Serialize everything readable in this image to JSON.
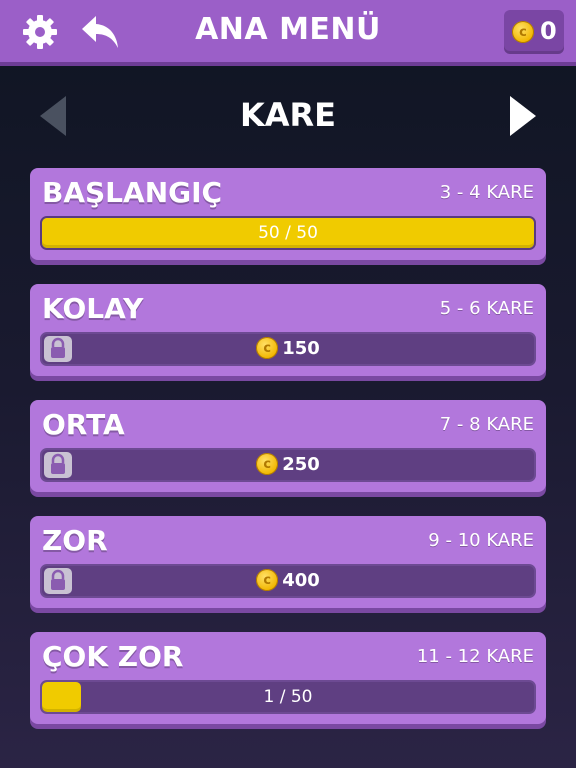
{
  "header": {
    "title": "ANA MENÜ",
    "coins": "0"
  },
  "selector": {
    "label": "KARE"
  },
  "levels": [
    {
      "name": "BAŞLANGIÇ",
      "range": "3 - 4 KARE",
      "locked": false,
      "progress_text": "50 / 50",
      "progress": 1.0
    },
    {
      "name": "KOLAY",
      "range": "5 - 6 KARE",
      "locked": true,
      "price": "150"
    },
    {
      "name": "ORTA",
      "range": "7 - 8 KARE",
      "locked": true,
      "price": "250"
    },
    {
      "name": "ZOR",
      "range": "9 - 10 KARE",
      "locked": true,
      "price": "400"
    },
    {
      "name": "ÇOK ZOR",
      "range": "11 - 12 KARE",
      "locked": false,
      "progress_text": "1 / 50",
      "progress": 0.02
    }
  ],
  "colors": {
    "topbar": "#9b5fc8",
    "card": "#b277dc",
    "progress_fill": "#f0cb00",
    "coin": "#f2b600"
  },
  "icons": [
    "gear-icon",
    "back-arrow-icon",
    "coin-icon",
    "arrow-left-icon",
    "arrow-right-icon",
    "lock-icon"
  ]
}
